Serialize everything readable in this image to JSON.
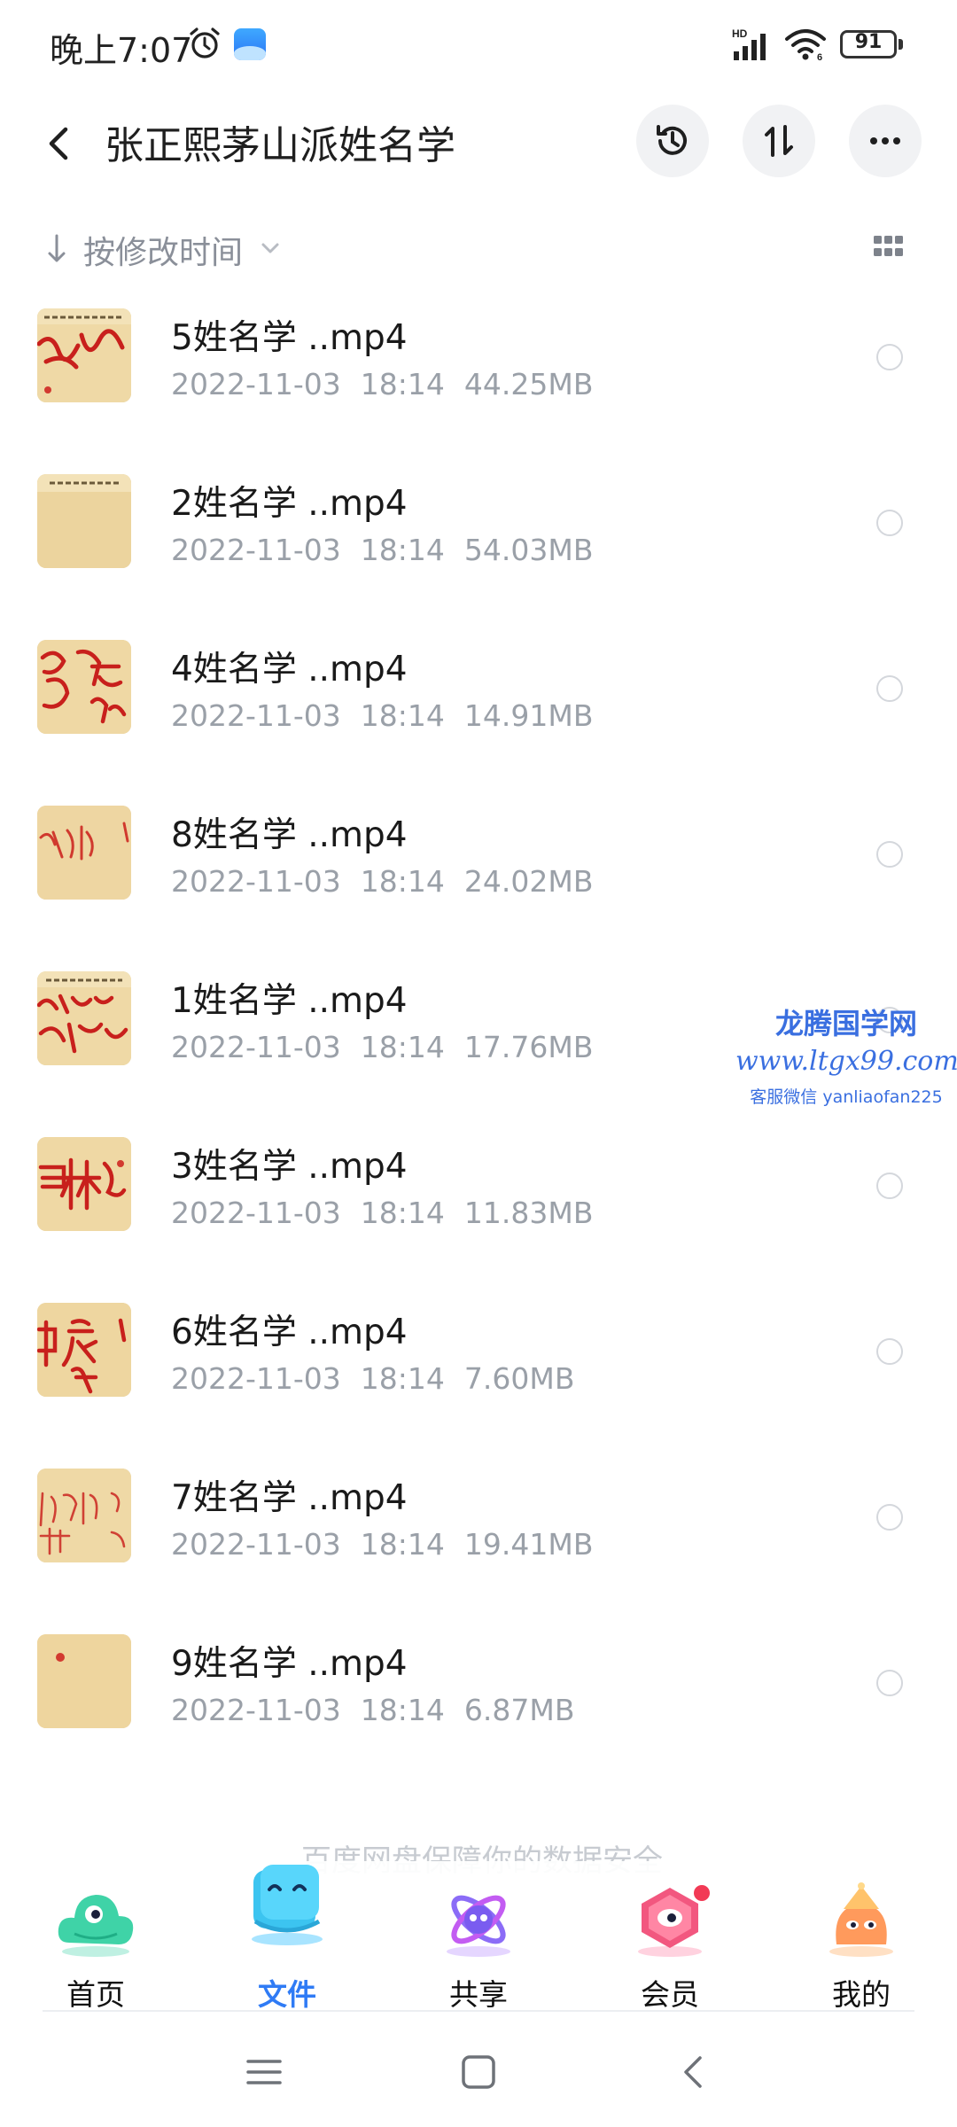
{
  "status_bar": {
    "time": "晚上7:07",
    "battery": "91",
    "network": "HD",
    "icons": [
      "alarm-icon",
      "app-badge-icon",
      "signal-icon",
      "wifi-icon",
      "battery-icon"
    ]
  },
  "header": {
    "title": "张正熙茅山派姓名学",
    "icons": [
      "back-arrow-icon",
      "history-icon",
      "sort-toggle-icon",
      "more-icon"
    ]
  },
  "sort": {
    "label": "按修改时间"
  },
  "files": [
    {
      "name": "5姓名学 ..mp4",
      "date": "2022-11-03",
      "time": "18:14",
      "size": "44.25MB"
    },
    {
      "name": "2姓名学 ..mp4",
      "date": "2022-11-03",
      "time": "18:14",
      "size": "54.03MB"
    },
    {
      "name": "4姓名学 ..mp4",
      "date": "2022-11-03",
      "time": "18:14",
      "size": "14.91MB"
    },
    {
      "name": "8姓名学 ..mp4",
      "date": "2022-11-03",
      "time": "18:14",
      "size": "24.02MB"
    },
    {
      "name": "1姓名学 ..mp4",
      "date": "2022-11-03",
      "time": "18:14",
      "size": "17.76MB"
    },
    {
      "name": "3姓名学 ..mp4",
      "date": "2022-11-03",
      "time": "18:14",
      "size": "11.83MB"
    },
    {
      "name": "6姓名学 ..mp4",
      "date": "2022-11-03",
      "time": "18:14",
      "size": "7.60MB"
    },
    {
      "name": "7姓名学 ..mp4",
      "date": "2022-11-03",
      "time": "18:14",
      "size": "19.41MB"
    },
    {
      "name": "9姓名学 ..mp4",
      "date": "2022-11-03",
      "time": "18:14",
      "size": "6.87MB"
    }
  ],
  "watermark": {
    "title": "龙腾国学网",
    "url": "www.ltgx99.com",
    "contact": "客服微信 yanliaofan225"
  },
  "tip": "百度网盘保障你的数据安全",
  "bottom_nav": [
    {
      "label": "首页",
      "icon": "home-cloud-icon"
    },
    {
      "label": "文件",
      "icon": "files-icon"
    },
    {
      "label": "共享",
      "icon": "share-icon"
    },
    {
      "label": "会员",
      "icon": "member-icon"
    },
    {
      "label": "我的",
      "icon": "profile-icon"
    }
  ],
  "system_nav": {
    "icons": [
      "menu-icon",
      "home-icon",
      "back-icon"
    ]
  },
  "colors": {
    "accent": "#2f7bf5",
    "meta_text": "#9aa0a8",
    "thumb_paper": "#ecd7a4",
    "ink_red": "#c8201c"
  }
}
